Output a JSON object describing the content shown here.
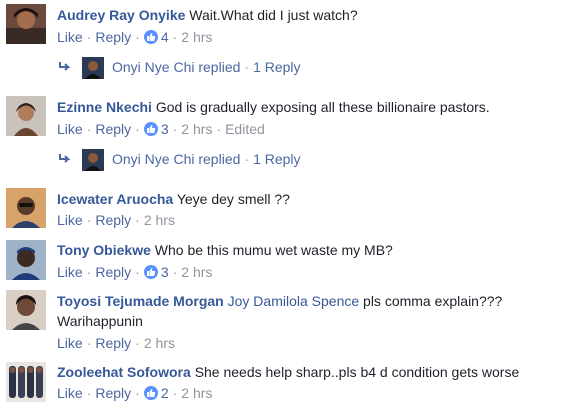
{
  "comments": [
    {
      "author": "Audrey Ray Onyike",
      "text": "Wait.What did I just watch?",
      "like": "Like",
      "reply": "Reply",
      "likes": "4",
      "time": "2 hrs",
      "reply_preview": {
        "name": "Onyi Nye Chi replied",
        "count": "1 Reply"
      }
    },
    {
      "author": "Ezinne Nkechi",
      "text": "God is gradually exposing all these billionaire pastors.",
      "like": "Like",
      "reply": "Reply",
      "likes": "3",
      "time": "2 hrs",
      "edited": "Edited",
      "reply_preview": {
        "name": "Onyi Nye Chi replied",
        "count": "1 Reply"
      }
    },
    {
      "author": "Icewater Aruocha",
      "text": "Yeye dey smell ??",
      "like": "Like",
      "reply": "Reply",
      "time": "2 hrs"
    },
    {
      "author": "Tony Obiekwe",
      "text": "Who be this mumu wet waste my MB?",
      "like": "Like",
      "reply": "Reply",
      "likes": "3",
      "time": "2 hrs"
    },
    {
      "author": "Toyosi Tejumade Morgan",
      "mention": "Joy Damilola Spence",
      "text": "pls comma explain??? Warihappunin",
      "like": "Like",
      "reply": "Reply",
      "time": "2 hrs"
    },
    {
      "author": "Zooleehat Sofowora",
      "text": "She needs help sharp..pls b4 d condition gets worse",
      "like": "Like",
      "reply": "Reply",
      "likes": "2",
      "time": "2 hrs"
    }
  ],
  "colors": {
    "author": "#365899",
    "link": "#4b67a1",
    "meta": "#90949c",
    "like_badge": "#5890ff",
    "text": "#1d2129"
  },
  "icons": {
    "like_badge": "thumbs-up-icon",
    "reply_arrow": "reply-arrow-icon"
  }
}
